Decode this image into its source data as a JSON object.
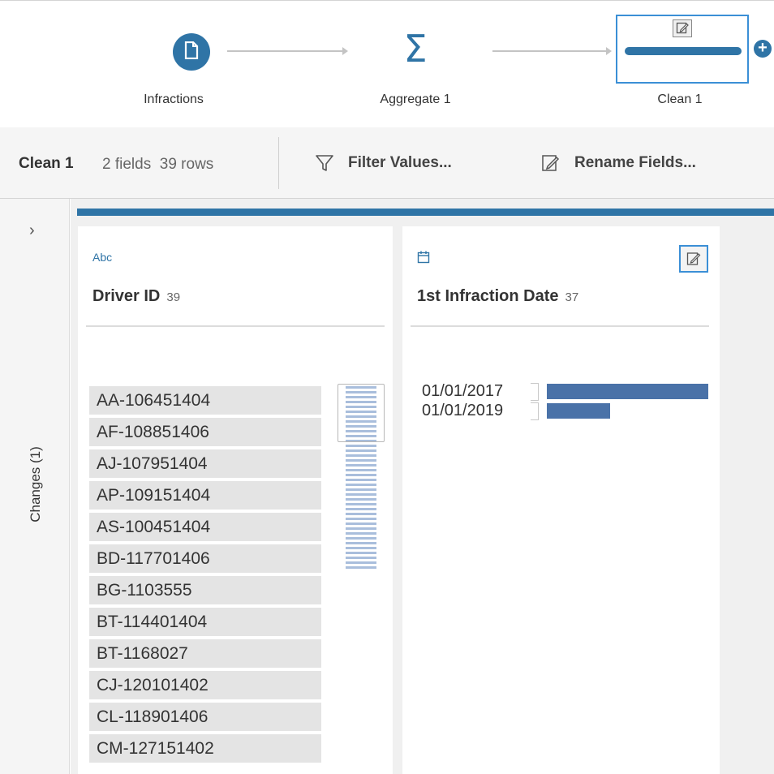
{
  "flow": {
    "steps": [
      {
        "label": "Infractions",
        "icon": "document-icon"
      },
      {
        "label": "Aggregate 1",
        "icon": "sigma-icon"
      },
      {
        "label": "Clean 1",
        "icon": "clean-step-icon"
      }
    ],
    "add_icon": "plus-icon"
  },
  "toolbar": {
    "title": "Clean 1",
    "meta": "2 fields  39 rows",
    "filter_label": "Filter Values...",
    "rename_label": "Rename Fields..."
  },
  "side_panel": {
    "changes_label": "Changes (1)"
  },
  "profile": {
    "cards": [
      {
        "type": "Abc",
        "name": "Driver ID",
        "count": "39",
        "values": [
          "AA-106451404",
          "AF-108851406",
          "AJ-107951404",
          "AP-109151404",
          "AS-100451404",
          "BD-117701406",
          "BG-1103555",
          "BT-114401404",
          "BT-1168027",
          "CJ-120101402",
          "CL-118901406",
          "CM-127151402"
        ]
      },
      {
        "type": "date",
        "name": "1st Infraction Date",
        "count": "37",
        "values": [
          {
            "label": "01/01/2017",
            "fraction": 1.0
          },
          {
            "label": "01/01/2019",
            "fraction": 0.39
          }
        ]
      }
    ]
  },
  "colors": {
    "accent": "#2f74a6",
    "selection": "#3b8fd6",
    "bar": "#4a72a8",
    "value_bg": "#e4e4e4"
  }
}
